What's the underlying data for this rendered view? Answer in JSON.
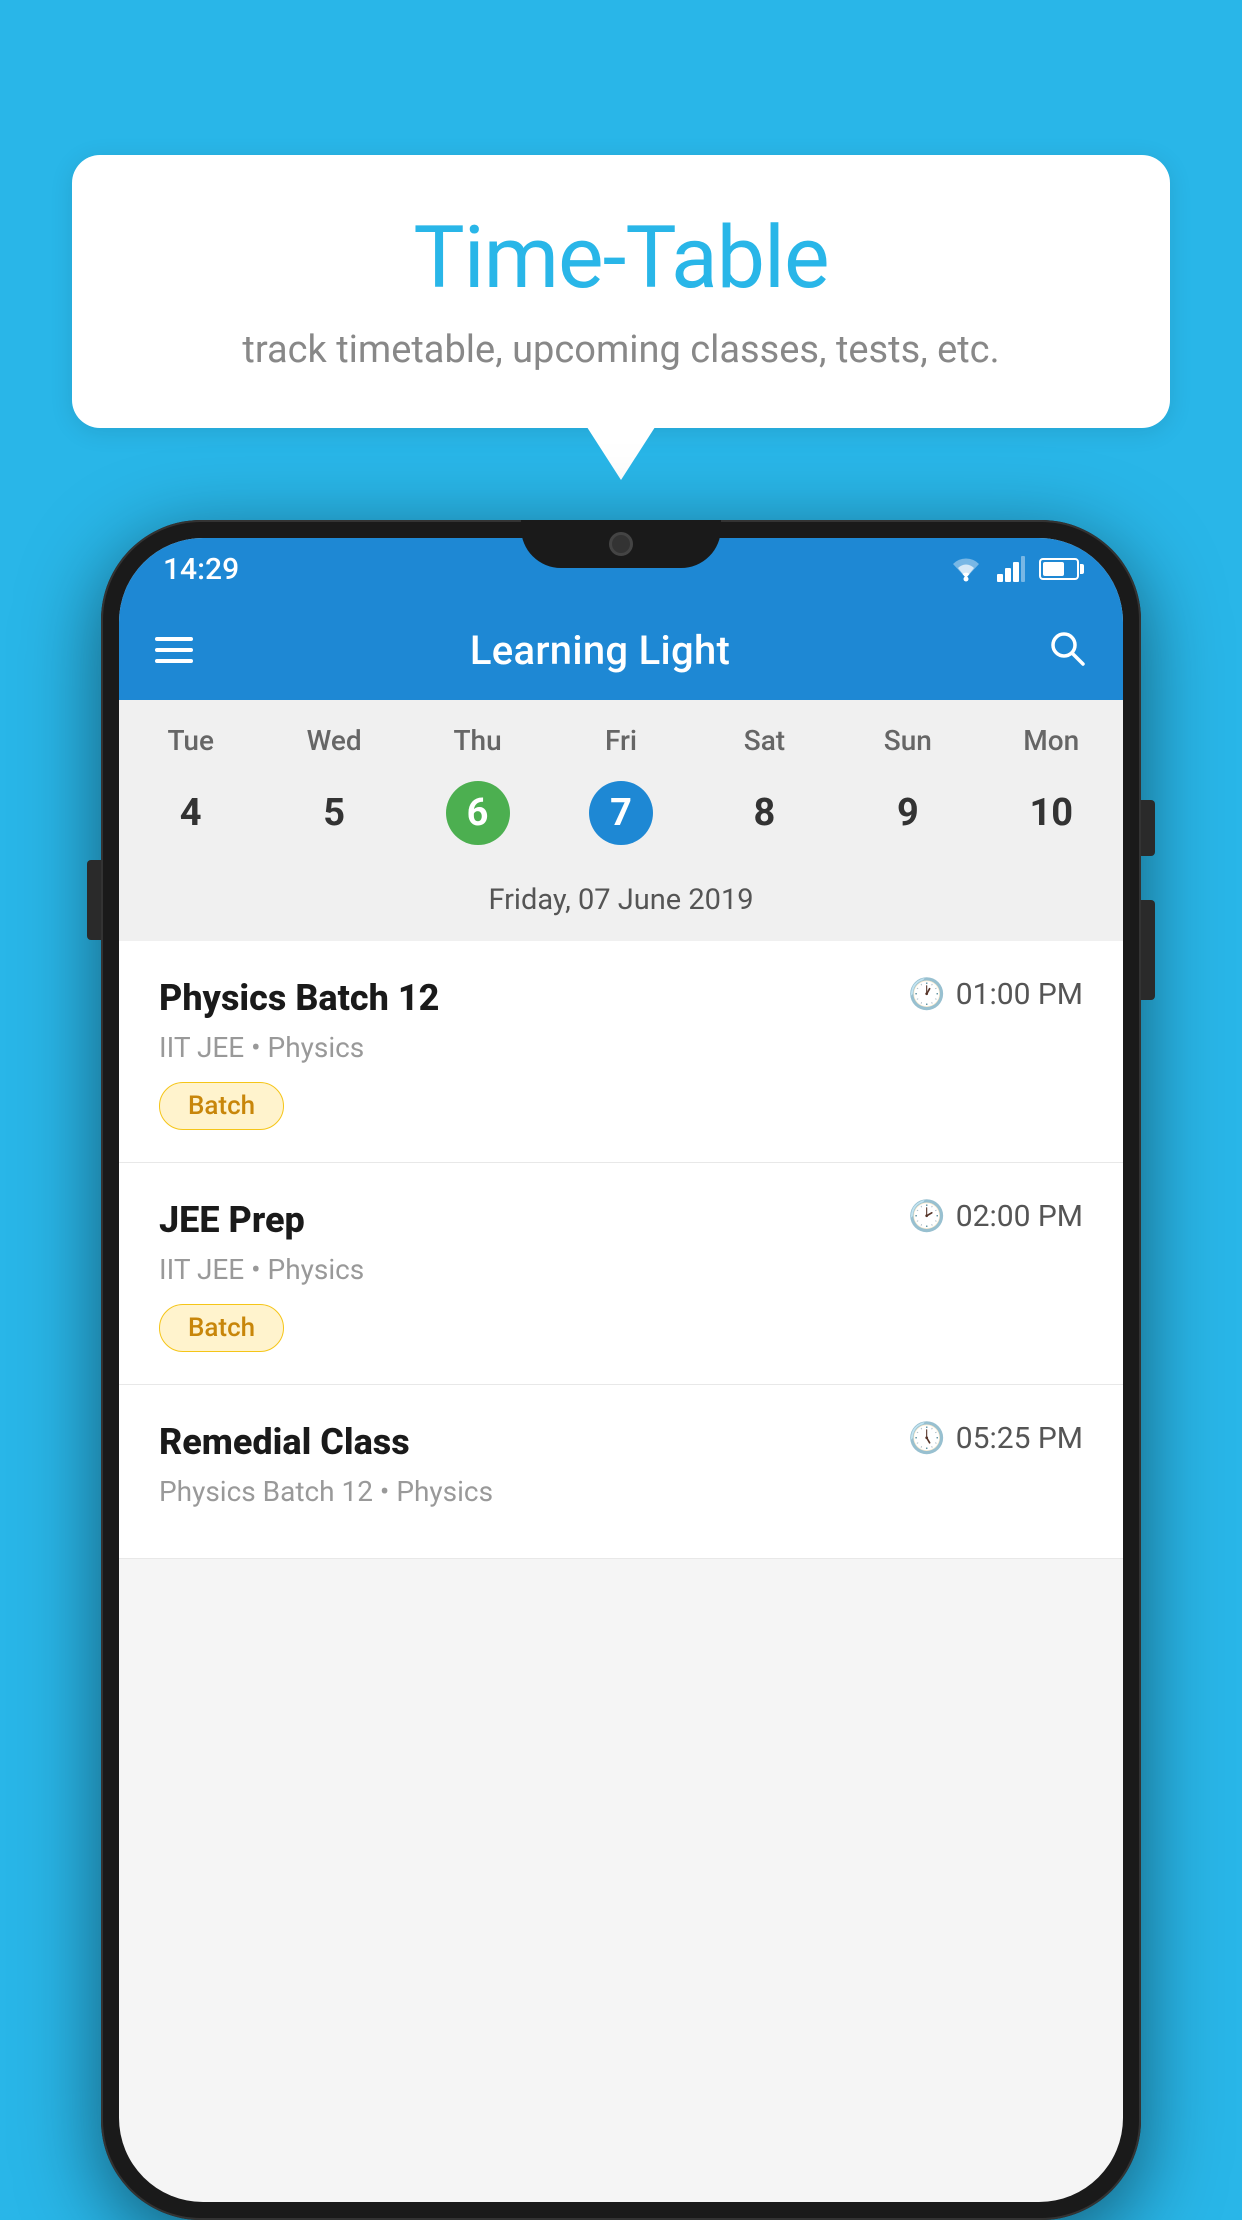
{
  "background_color": "#29B6E8",
  "bubble": {
    "title": "Time-Table",
    "subtitle": "track timetable, upcoming classes, tests, etc."
  },
  "phone": {
    "status_bar": {
      "time": "14:29"
    },
    "app_bar": {
      "title": "Learning Light"
    },
    "calendar": {
      "days_of_week": [
        "Tue",
        "Wed",
        "Thu",
        "Fri",
        "Sat",
        "Sun",
        "Mon"
      ],
      "dates": [
        "4",
        "5",
        "6",
        "7",
        "8",
        "9",
        "10"
      ],
      "today_index": 2,
      "selected_index": 3,
      "selected_date_label": "Friday, 07 June 2019"
    },
    "schedule": [
      {
        "title": "Physics Batch 12",
        "time": "01:00 PM",
        "detail": "IIT JEE • Physics",
        "tag": "Batch"
      },
      {
        "title": "JEE Prep",
        "time": "02:00 PM",
        "detail": "IIT JEE • Physics",
        "tag": "Batch"
      },
      {
        "title": "Remedial Class",
        "time": "05:25 PM",
        "detail": "Physics Batch 12 • Physics",
        "tag": ""
      }
    ]
  }
}
